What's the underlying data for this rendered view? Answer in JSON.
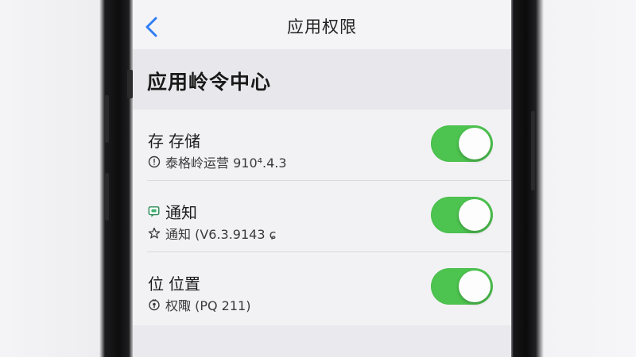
{
  "nav": {
    "title": "应用权限"
  },
  "section": {
    "title": "应用岭令中心"
  },
  "rows": [
    {
      "prefix": "存",
      "title": "存储",
      "subtitle": "泰格岭运营 910⁴.4.3",
      "enabled": true
    },
    {
      "title": "通知",
      "subtitle": "通知 (V6.3.9143 ɕ",
      "enabled": true
    },
    {
      "prefix": "位",
      "title": "位置",
      "subtitle": "权陬 (PQ 211)",
      "enabled": true
    }
  ],
  "colors": {
    "accent": "#2f7df6",
    "toggle_on": "#4dc44f",
    "background": "#f2f2f4"
  },
  "icons": [
    "back-chevron-icon",
    "info-circle-icon",
    "chat-bubble-icon",
    "star-icon",
    "location-pin-icon"
  ]
}
